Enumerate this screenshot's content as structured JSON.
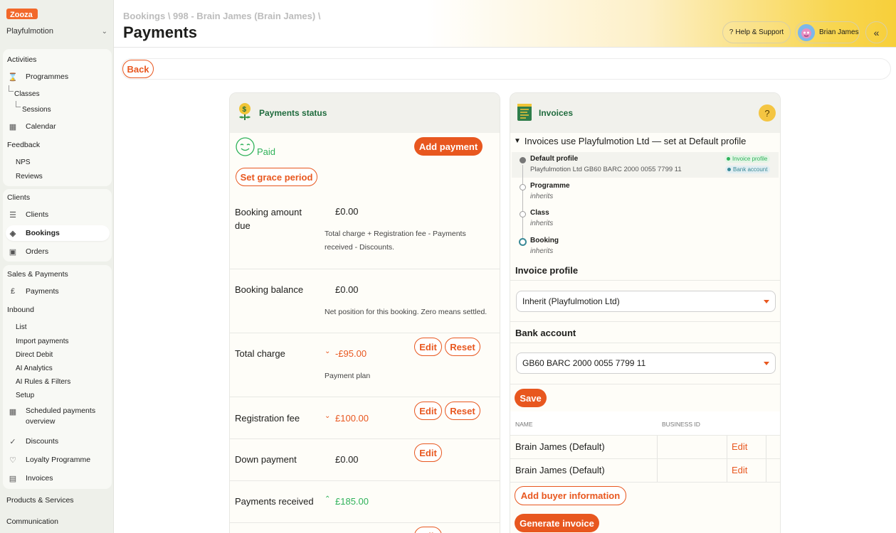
{
  "brand": {
    "logo_text": "Zooza",
    "accent": "#e8571f",
    "green": "#1f6b3d"
  },
  "sidebar": {
    "org": "Playfulmotion",
    "activities": {
      "title": "Activities",
      "items": [
        {
          "label": "Programmes",
          "icon": "hourglass-icon"
        },
        {
          "label": "Classes"
        },
        {
          "label": "Sessions"
        },
        {
          "label": "Calendar",
          "icon": "calendar-icon"
        }
      ]
    },
    "feedback": {
      "title": "Feedback",
      "items": [
        {
          "label": "NPS"
        },
        {
          "label": "Reviews"
        }
      ]
    },
    "clients": {
      "title": "Clients",
      "items": [
        {
          "label": "Clients",
          "icon": "clients-icon"
        },
        {
          "label": "Bookings",
          "icon": "bookings-icon"
        },
        {
          "label": "Orders",
          "icon": "orders-icon"
        }
      ]
    },
    "sales": {
      "title": "Sales & Payments",
      "payments": "Payments",
      "inbound": "Inbound",
      "inbound_items": [
        "List",
        "Import payments",
        "Direct Debit",
        "AI Analytics",
        "AI Rules & Filters",
        "Setup"
      ],
      "scheduled": "Scheduled payments overview",
      "discounts": "Discounts",
      "loyalty": "Loyalty Programme",
      "invoices": "Invoices"
    },
    "products": "Products & Services",
    "communication": "Communication"
  },
  "header": {
    "breadcrumb": "Bookings \\ 998 - Brain James (Brain James) \\",
    "title": "Payments",
    "help": "Help & Support",
    "user": "Brian James"
  },
  "back": "Back",
  "payments": {
    "title": "Payments status",
    "status": "Paid",
    "add_payment": "Add payment",
    "grace": "Set grace period",
    "rows": [
      {
        "label": "Booking amount due",
        "value": "£0.00",
        "desc": "Total charge + Registration fee - Payments received - Discounts."
      },
      {
        "label": "Booking balance",
        "value": "£0.00",
        "desc": "Net position for this booking. Zero means settled."
      },
      {
        "label": "Total charge",
        "value": "-£95.00",
        "desc": "Payment plan",
        "edit": "Edit",
        "reset": "Reset"
      },
      {
        "label": "Registration fee",
        "value": "£100.00",
        "edit": "Edit",
        "reset": "Reset"
      },
      {
        "label": "Down payment",
        "value": "£0.00",
        "edit": "Edit"
      },
      {
        "label": "Payments received",
        "value": "£185.00"
      }
    ],
    "last_edit": "Edit"
  },
  "invoices": {
    "title": "Invoices",
    "help": "?",
    "summary": "Invoices use Playfulmotion Ltd — set at Default profile",
    "timeline": [
      {
        "name": "Default profile",
        "sub": "Playfulmotion Ltd GB60 BARC 2000 0055 7799 11",
        "badges": [
          "Invoice profile",
          "Bank account"
        ]
      },
      {
        "name": "Programme",
        "sub": "inherits"
      },
      {
        "name": "Class",
        "sub": "inherits"
      },
      {
        "name": "Booking",
        "sub": "inherits"
      }
    ],
    "invoice_profile_label": "Invoice profile",
    "invoice_profile_value": "Inherit (Playfulmotion Ltd)",
    "bank_label": "Bank account",
    "bank_value": "GB60 BARC 2000 0055 7799 11",
    "save": "Save",
    "table_headers": [
      "NAME",
      "BUSINESS ID"
    ],
    "table_rows": [
      {
        "name": "Brain James (Default)",
        "business_id": "",
        "action": "Edit"
      },
      {
        "name": "Brain James (Default)",
        "business_id": "",
        "action": "Edit"
      }
    ],
    "add_buyer": "Add buyer information",
    "generate": "Generate invoice"
  }
}
